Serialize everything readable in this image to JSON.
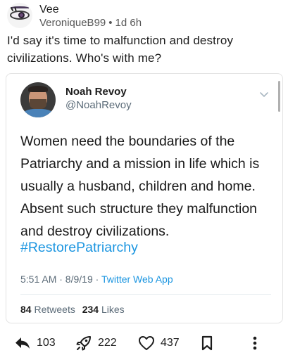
{
  "post": {
    "author": "Vee",
    "username": "VeroniqueB99",
    "separator": "•",
    "age": "1d 6h",
    "text": "I'd say it's time to malfunction and destroy civilizations. Who's with me?"
  },
  "tweet": {
    "name": "Noah Revoy",
    "handle": "@NoahRevoy",
    "body": "Women need the boundaries of the Patriarchy and a mission in life which is usually a husband, children and home. Absent such structure they malfunction and destroy civilizations.",
    "hashtag": "#RestorePatriarchy",
    "time": "5:51 AM · 8/9/19 ·",
    "source": "Twitter Web App",
    "retweets_count": "84",
    "retweets_label": "Retweets",
    "likes_count": "234",
    "likes_label": "Likes"
  },
  "actions": {
    "reply_count": "103",
    "boost_count": "222",
    "like_count": "437"
  },
  "colors": {
    "link": "#1b95e0",
    "muted": "#5b6b78"
  },
  "icons": [
    "eye-avatar-icon",
    "chevron-down-icon",
    "reply-arrow-icon",
    "rocket-icon",
    "heart-icon",
    "bookmark-icon",
    "more-vertical-icon"
  ]
}
